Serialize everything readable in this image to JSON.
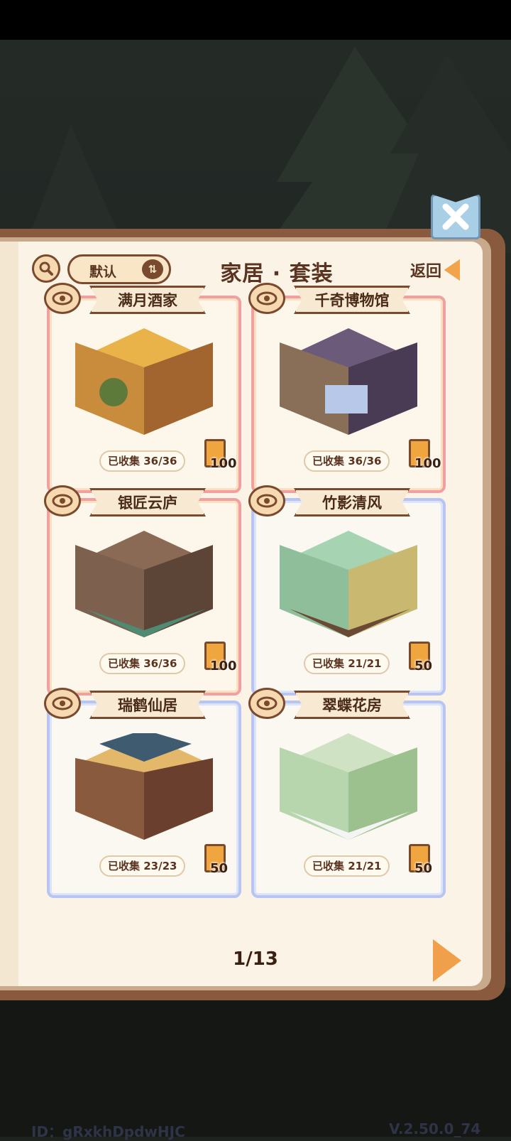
{
  "header": {
    "sort_label": "默认",
    "sort_icon": "sort-icon",
    "title": "家居 · 套装",
    "back_label": "返回"
  },
  "cards": [
    {
      "name": "满月酒家",
      "collected": "已收集 36/36",
      "points": "100",
      "tier": "gold"
    },
    {
      "name": "千奇博物馆",
      "collected": "已收集 36/36",
      "points": "100",
      "tier": "gold"
    },
    {
      "name": "银匠云庐",
      "collected": "已收集 36/36",
      "points": "100",
      "tier": "gold"
    },
    {
      "name": "竹影清风",
      "collected": "已收集 21/21",
      "points": "50",
      "tier": "blue"
    },
    {
      "name": "瑞鹤仙居",
      "collected": "已收集 23/23",
      "points": "50",
      "tier": "blue"
    },
    {
      "name": "翠蝶花房",
      "collected": "已收集 21/21",
      "points": "50",
      "tier": "blue"
    }
  ],
  "pager": {
    "current": "1/13"
  },
  "footer": {
    "id": "ID：gRxkhDpdwHJC",
    "version": "V.2.50.0_74"
  },
  "icons": {
    "close": "close-icon",
    "search": "search-icon",
    "eye": "eye-icon",
    "next": "next-arrow-icon",
    "back": "back-arrow-icon"
  }
}
